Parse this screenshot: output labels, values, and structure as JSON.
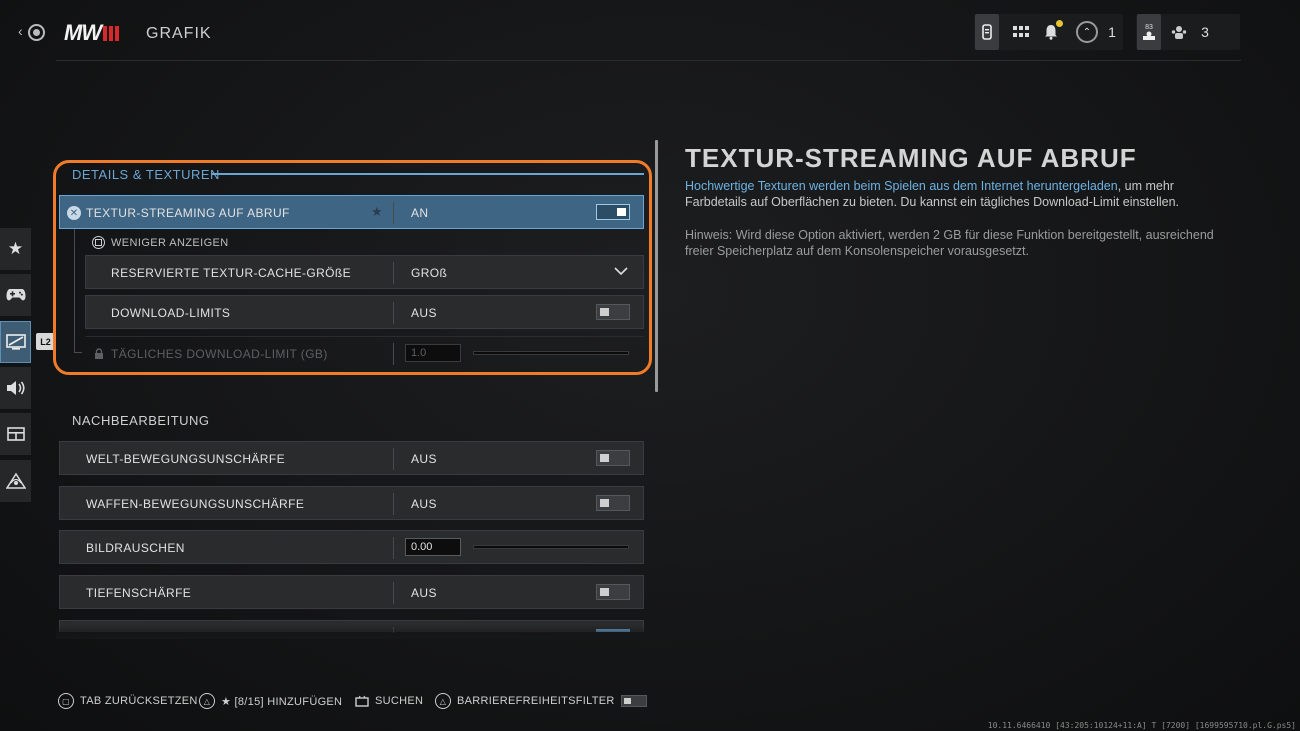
{
  "header": {
    "title": "GRAFIK",
    "logo_text": "MW",
    "rank_count": "1",
    "party_level": "83",
    "party_count": "3"
  },
  "sidebar_badge": "L2",
  "sections": {
    "details": {
      "title": "DETAILS & TEXTUREN",
      "rows": [
        {
          "label": "TEXTUR-STREAMING AUF ABRUF",
          "value": "AN"
        },
        {
          "label": "RESERVIERTE TEXTUR-CACHE-GRÖßE",
          "value": "GROß"
        },
        {
          "label": "DOWNLOAD-LIMITS",
          "value": "AUS"
        },
        {
          "label": "TÄGLICHES DOWNLOAD-LIMIT (GB)",
          "value": "1.0"
        }
      ],
      "collapse_label": "WENIGER ANZEIGEN"
    },
    "post": {
      "title": "NACHBEARBEITUNG",
      "rows": [
        {
          "label": "WELT-BEWEGUNGSUNSCHÄRFE",
          "value": "AUS"
        },
        {
          "label": "WAFFEN-BEWEGUNGSUNSCHÄRFE",
          "value": "AUS"
        },
        {
          "label": "BILDRAUSCHEN",
          "value": "0.00"
        },
        {
          "label": "TIEFENSCHÄRFE",
          "value": "AUS"
        }
      ]
    }
  },
  "description": {
    "title": "TEXTUR-STREAMING AUF ABRUF",
    "highlight": "Hochwertige Texturen werden beim Spielen aus dem Internet heruntergeladen",
    "body_rest": ", um mehr Farbdetails auf Oberflächen zu bieten. Du kannst ein tägliches Download-Limit einstellen.",
    "note": "Hinweis: Wird diese Option aktiviert, werden 2 GB für diese Funktion bereitgestellt, ausreichend freier Speicherplatz auf dem Konsolenspeicher vorausgesetzt."
  },
  "footer": {
    "reset": "TAB ZURÜCKSETZEN",
    "favorite": "★ [8/15] HINZUFÜGEN",
    "search": "SUCHEN",
    "accessibility": "BARRIEREFREIHEITSFILTER"
  },
  "debug_text": "10.11.6466410 [43:205:10124+11:A] T [7200] [1699595710.pl.G.ps5]",
  "colors": {
    "accent_blue": "#6aa5d3",
    "highlight_orange": "#f07c2a",
    "brand_red": "#d9282b"
  }
}
